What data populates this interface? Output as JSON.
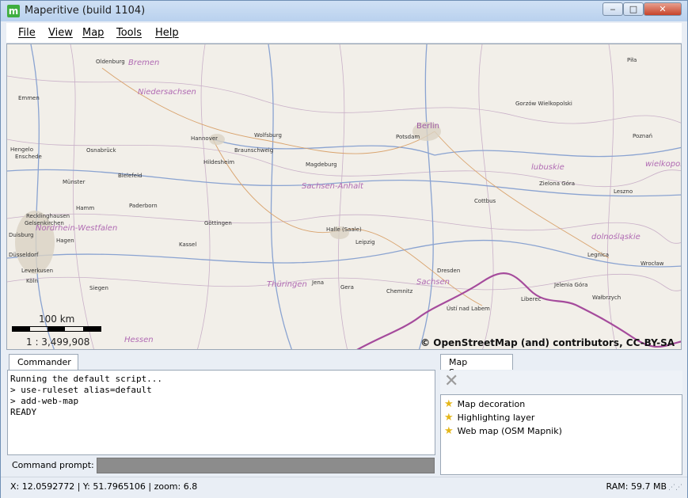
{
  "window": {
    "title": "Maperitive (build 1104)",
    "app_icon_letter": "m",
    "controls": {
      "minimize": "‒",
      "maximize": "□",
      "close": "✕"
    }
  },
  "menu": [
    "File",
    "View",
    "Map",
    "Tools",
    "Help"
  ],
  "map": {
    "cities": [
      "Oldenburg",
      "Emmen",
      "Hengelo",
      "Enschede",
      "Münster",
      "Recklinghausen",
      "Gelsenkirchen",
      "Duisburg",
      "Düsseldorf",
      "Leverkusen",
      "Köln",
      "Siegen",
      "Hamm",
      "Hagen",
      "Bielefeld",
      "Osnabrück",
      "Hannover",
      "Hildesheim",
      "Braunschweig",
      "Wolfsburg",
      "Magdeburg",
      "Paderborn",
      "Göttingen",
      "Kassel",
      "Halle (Saale)",
      "Leipzig",
      "Jena",
      "Gera",
      "Chemnitz",
      "Dresden",
      "Ústí nad Labem",
      "Liberec",
      "Jelenia Góra",
      "Wałbrzych",
      "Wrocław",
      "Legnica",
      "Cottbus",
      "Zielona Góra",
      "Leszno",
      "Poznań",
      "Gorzów Wielkopolski",
      "Piła",
      "Potsdam",
      "Berlin"
    ],
    "regions": [
      "Bremen",
      "Niedersachsen",
      "Nordrhein-Westfalen",
      "Sachsen-Anhalt",
      "Thüringen",
      "Sachsen",
      "Hessen",
      "lubuskie",
      "dolnośląskie",
      "wielkopols"
    ],
    "scale_distance": "100 km",
    "scale_ratio": "1 : 3,499,908",
    "attribution": "© OpenStreetMap (and) contributors, CC-BY-SA"
  },
  "commander": {
    "tab_label": "Commander",
    "output": [
      "Running the default script...",
      "> use-ruleset alias=default",
      "> add-web-map",
      "READY"
    ],
    "prompt_label": "Command prompt:",
    "prompt_value": ""
  },
  "map_sources": {
    "tab_label": "Map Sources",
    "delete_icon": "✕",
    "items": [
      "Map decoration",
      "Highlighting layer",
      "Web map (OSM Mapnik)"
    ]
  },
  "status": {
    "coords": "X: 12.0592772 | Y: 51.7965106  | zoom: 6.8",
    "ram": "RAM: 59.7 MB"
  }
}
